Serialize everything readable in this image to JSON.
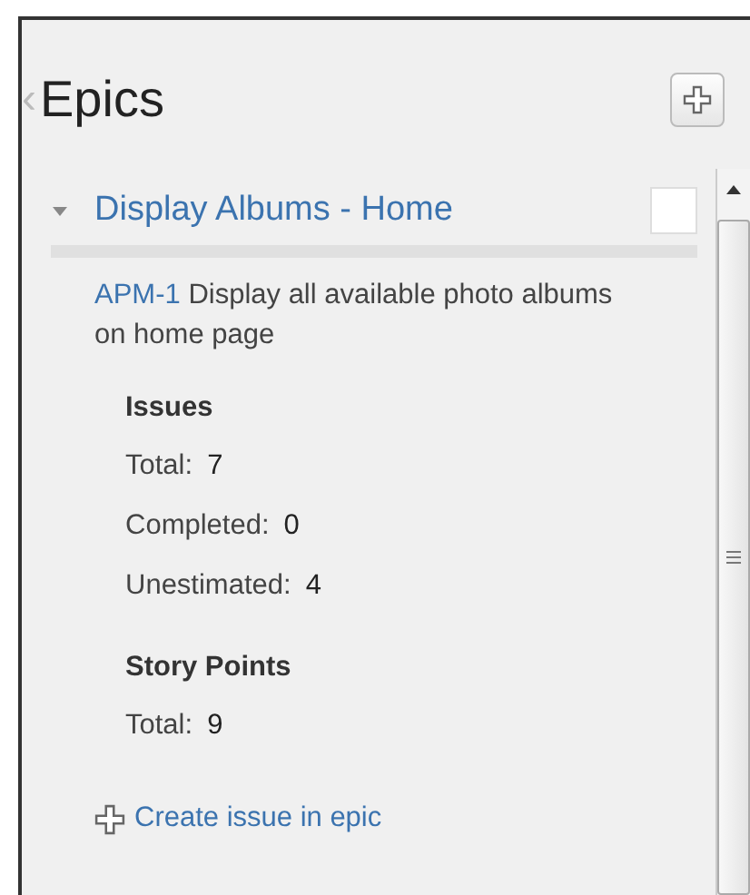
{
  "panel": {
    "title": "Epics",
    "back_icon": "‹"
  },
  "epic": {
    "title": "Display Albums - Home",
    "expanded": true,
    "checked": false,
    "key": "APM-1",
    "description": "Display all available photo albums on home page",
    "groups": [
      {
        "heading": "Issues",
        "rows": [
          {
            "label": "Total:",
            "value": "7"
          },
          {
            "label": "Completed:",
            "value": "0"
          },
          {
            "label": "Unestimated:",
            "value": "4"
          }
        ]
      },
      {
        "heading": "Story Points",
        "rows": [
          {
            "label": "Total:",
            "value": "9"
          }
        ]
      }
    ],
    "create_link": "Create issue in epic"
  }
}
